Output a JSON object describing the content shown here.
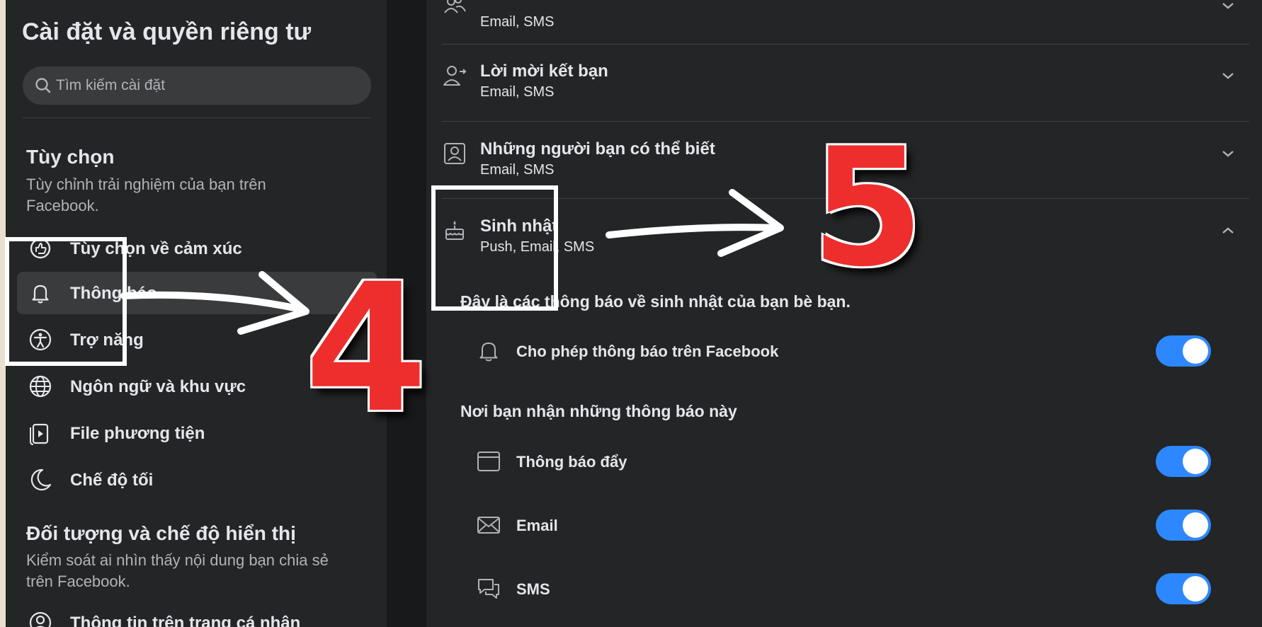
{
  "sidebar": {
    "title": "Cài đặt và quyền riêng tư",
    "search_placeholder": "Tìm kiếm cài đặt",
    "preferences": {
      "title": "Tùy chọn",
      "description": "Tùy chỉnh trải nghiệm của bạn trên Facebook."
    },
    "items": [
      {
        "label": "Tùy chọn về cảm xúc",
        "icon": "reactions-icon"
      },
      {
        "label": "Thông báo",
        "icon": "bell-icon",
        "active": true
      },
      {
        "label": "Trợ năng",
        "icon": "accessibility-icon"
      },
      {
        "label": "Ngôn ngữ và khu vực",
        "icon": "globe-icon"
      },
      {
        "label": "File phương tiện",
        "icon": "media-file-icon"
      },
      {
        "label": "Chế độ tối",
        "icon": "moon-icon"
      }
    ],
    "audience": {
      "title": "Đối tượng và chế độ hiển thị",
      "description": "Kiểm soát ai nhìn thấy nội dung bạn chia sẻ trên Facebook."
    },
    "audience_items": [
      {
        "label": "Thông tin trên trang cá nhân",
        "icon": "profile-icon"
      }
    ]
  },
  "main": {
    "categories": [
      {
        "title": "",
        "subtitle": "Email, SMS",
        "icon": "people-icon",
        "expanded": false
      },
      {
        "title": "Lời mời kết bạn",
        "subtitle": "Email, SMS",
        "icon": "friend-request-icon",
        "expanded": false
      },
      {
        "title": "Những người bạn có thể biết",
        "subtitle": "Email, SMS",
        "icon": "contact-card-icon",
        "expanded": false
      },
      {
        "title": "Sinh nhật",
        "subtitle": "Push, Email, SMS",
        "icon": "birthday-cake-icon",
        "expanded": true
      }
    ],
    "birthday_description": "Đây là các thông báo về sinh nhật của bạn bè bạn.",
    "allow_toggle": {
      "label": "Cho phép thông báo trên Facebook",
      "icon": "bell-icon",
      "on": true
    },
    "where_heading": "Nơi bạn nhận những thông báo này",
    "channels": [
      {
        "label": "Thông báo đẩy",
        "icon": "browser-window-icon",
        "on": true
      },
      {
        "label": "Email",
        "icon": "envelope-icon",
        "on": true
      },
      {
        "label": "SMS",
        "icon": "chat-bubbles-icon",
        "on": true
      }
    ]
  },
  "annotations": {
    "step4": "4",
    "step5": "5"
  },
  "colors": {
    "panel": "#242526",
    "background": "#18191a",
    "toggle_on": "#2d88ff",
    "annotation_red": "#ee2d2d"
  }
}
